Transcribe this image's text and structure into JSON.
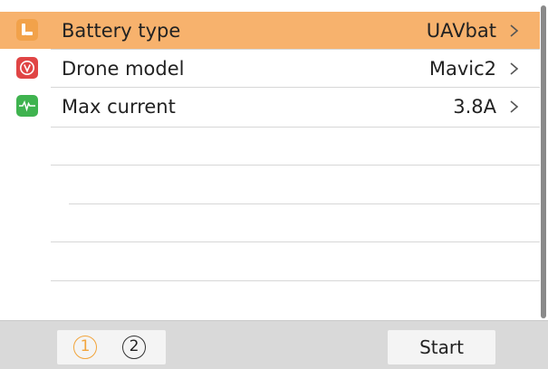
{
  "settings": {
    "rows": [
      {
        "label": "Battery type",
        "value": "UAVbat",
        "icon": "battery-icon",
        "icon_color": "#f2a24a",
        "selected": true
      },
      {
        "label": "Drone model",
        "value": "Mavic2",
        "icon": "drone-model-icon",
        "icon_color": "#e04545",
        "selected": false
      },
      {
        "label": "Max current",
        "value": "3.8A",
        "icon": "pulse-icon",
        "icon_color": "#3fb34f",
        "selected": false
      }
    ]
  },
  "footer": {
    "pages": [
      "①",
      "②"
    ],
    "active_page": 1,
    "start_label": "Start"
  },
  "colors": {
    "selected_row": "#f7b26d",
    "accent": "#f2a43b",
    "footer_bg": "#d9d9d9"
  }
}
